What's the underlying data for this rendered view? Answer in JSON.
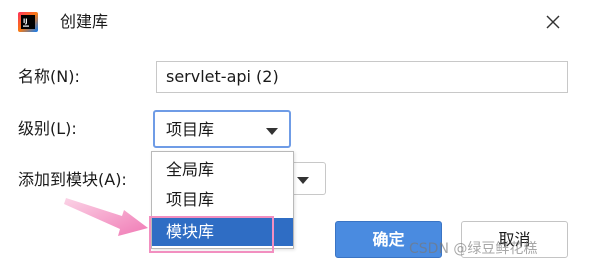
{
  "title": "创建库",
  "app_icon": "intellij-idea-icon",
  "fields": {
    "name_label": "名称(N):",
    "name_value": "servlet-api (2)",
    "level_label": "级别(L):",
    "level_value": "项目库",
    "module_label": "添加到模块(A):"
  },
  "dropdown": {
    "items": [
      "全局库",
      "项目库",
      "模块库"
    ],
    "selected_index": 2
  },
  "buttons": {
    "ok": "确定",
    "cancel": "取消"
  },
  "watermark": "CSDN @绿豆鲜花糕",
  "colors": {
    "accent": "#2f6dc4",
    "ok_button": "#4a8be0",
    "annotation_pink": "#f28fc0",
    "focus_border": "#6f9ce6"
  }
}
